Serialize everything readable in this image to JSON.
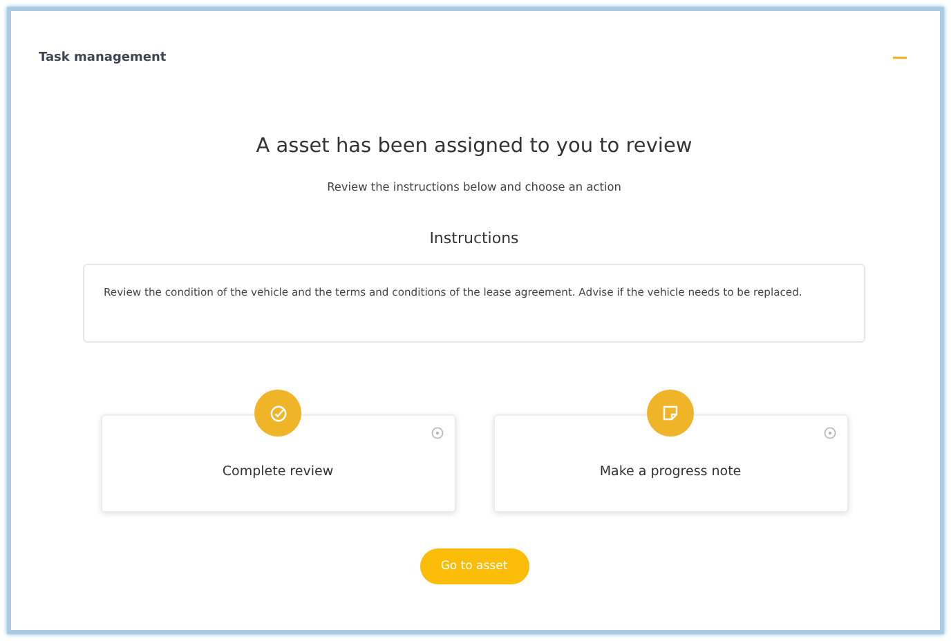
{
  "panel": {
    "title": "Task management",
    "expanded": true
  },
  "heading": "A asset has been assigned to you to review",
  "subheading": "Review the instructions below and choose an action",
  "instructions": {
    "title": "Instructions",
    "text": "Review the condition of the vehicle and the terms and conditions of the lease agreement. Advise if the vehicle needs to be replaced."
  },
  "actions": [
    {
      "kind": "review",
      "label": "Complete review"
    },
    {
      "kind": "note",
      "label": "Make a progress note"
    }
  ],
  "primary_button": "Go to asset"
}
